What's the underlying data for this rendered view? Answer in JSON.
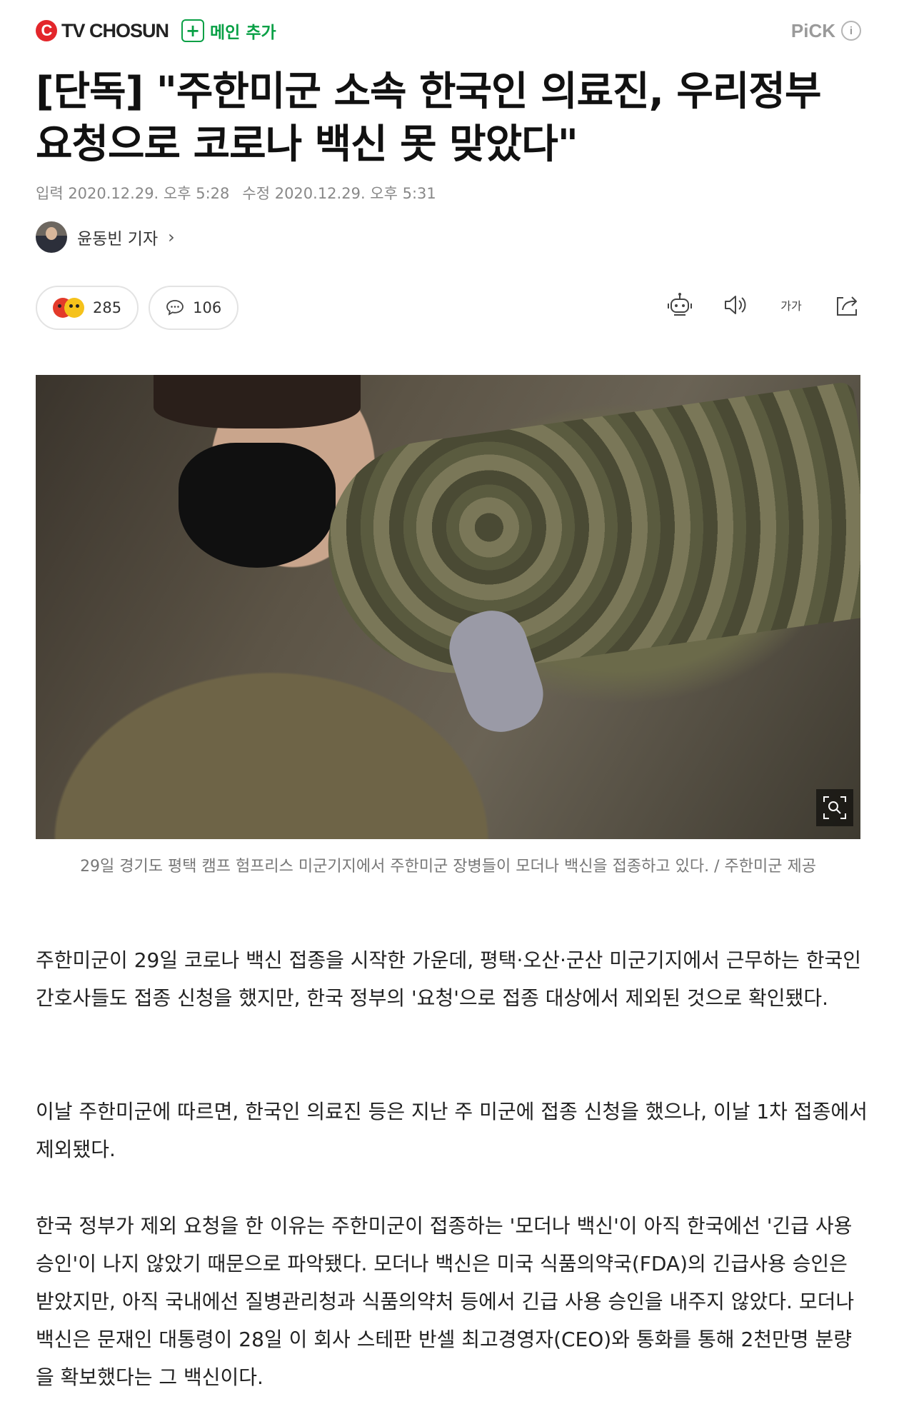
{
  "header": {
    "brand": "TV CHOSUN",
    "add_main_label": "메인 추가",
    "pick_label": "PiCK"
  },
  "article": {
    "title": "[단독] \"주한미군 소속 한국인 의료진, 우리정부 요청으로 코로나 백신 못 맞았다\"",
    "input_date": "입력 2020.12.29. 오후 5:28",
    "modified_date": "수정 2020.12.29. 오후 5:31",
    "reporter": "윤동빈 기자",
    "reaction_count": "285",
    "comment_count": "106",
    "font_size_label": "가가",
    "photo_caption": "29일 경기도 평택 캠프 험프리스 미군기지에서 주한미군 장병들이 모더나 백신을 접종하고 있다. / 주한미군 제공",
    "paragraphs": [
      "주한미군이 29일 코로나 백신 접종을 시작한 가운데, 평택·오산·군산 미군기지에서 근무하는 한국인 간호사들도 접종 신청을 했지만, 한국 정부의 '요청'으로 접종 대상에서 제외된 것으로 확인됐다.",
      "이날 주한미군에 따르면, 한국인 의료진 등은 지난 주 미군에 접종 신청을 했으나, 이날 1차 접종에서 제외됐다.",
      "한국 정부가 제외 요청을 한 이유는 주한미군이 접종하는 '모더나 백신'이 아직 한국에선 '긴급 사용 승인'이 나지 않았기 때문으로 파악됐다. 모더나 백신은 미국 식품의약국(FDA)의 긴급사용 승인은 받았지만, 아직 국내에선 질병관리청과 식품의약처 등에서 긴급 사용 승인을 내주지 않았다. 모더나 백신은 문재인 대통령이 28일 이 회사 스테판 반셀 최고경영자(CEO)와 통화를 통해 2천만명 분량을 확보했다는 그 백신이다."
    ]
  },
  "icons": {
    "brand": "tv-chosun-logo-icon",
    "add": "plus-box-icon",
    "info": "info-icon",
    "robot": "summary-robot-icon",
    "speaker": "text-to-speech-icon",
    "share": "share-icon",
    "comment": "comment-bubble-icon",
    "zoom": "image-zoom-icon"
  },
  "colors": {
    "brand_red": "#e3262b",
    "add_green": "#08a045",
    "muted_text": "#888888"
  }
}
